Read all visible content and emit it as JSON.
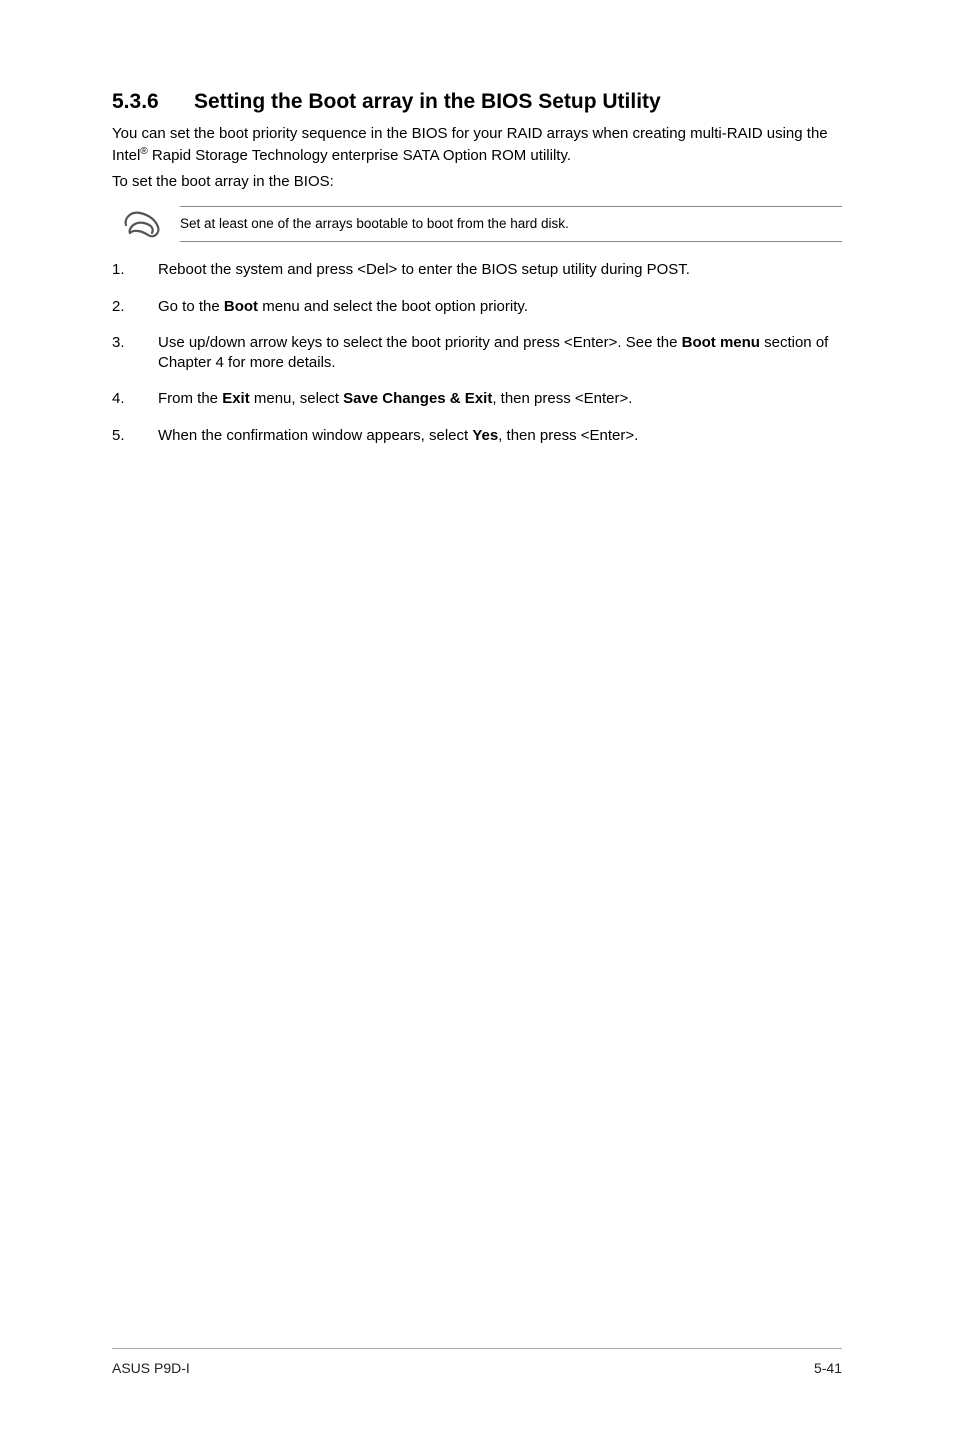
{
  "heading": {
    "num": "5.3.6",
    "title": "Setting the Boot array in the BIOS Setup Utility"
  },
  "intro": {
    "p1a": "You can set the boot priority sequence in the BIOS for your RAID arrays when creating multi-RAID using the Intel",
    "sup": "®",
    "p1b": " Rapid Storage Technology enterprise SATA Option ROM utililty.",
    "p2": "To set the boot array in the BIOS:"
  },
  "note": "Set at least one of the arrays bootable to boot from the hard disk.",
  "steps": [
    {
      "n": "1.",
      "parts": [
        {
          "t": "Reboot the system and press <Del> to enter the BIOS setup utility during POST."
        }
      ]
    },
    {
      "n": "2.",
      "parts": [
        {
          "t": "Go to the "
        },
        {
          "t": "Boot",
          "b": true
        },
        {
          "t": " menu and select the boot option priority."
        }
      ]
    },
    {
      "n": "3.",
      "parts": [
        {
          "t": "Use up/down arrow keys to select the boot priority and press <Enter>. See the "
        },
        {
          "t": "Boot menu",
          "b": true
        },
        {
          "t": " section of Chapter 4 for more details."
        }
      ]
    },
    {
      "n": "4.",
      "parts": [
        {
          "t": "From the "
        },
        {
          "t": "Exit",
          "b": true
        },
        {
          "t": " menu, select "
        },
        {
          "t": "Save Changes & Exit",
          "b": true
        },
        {
          "t": ", then press <Enter>."
        }
      ]
    },
    {
      "n": "5.",
      "parts": [
        {
          "t": "When the confirmation window appears, select "
        },
        {
          "t": "Yes",
          "b": true
        },
        {
          "t": ", then press <Enter>."
        }
      ]
    }
  ],
  "footer": {
    "left": "ASUS P9D-I",
    "right": "5-41"
  }
}
